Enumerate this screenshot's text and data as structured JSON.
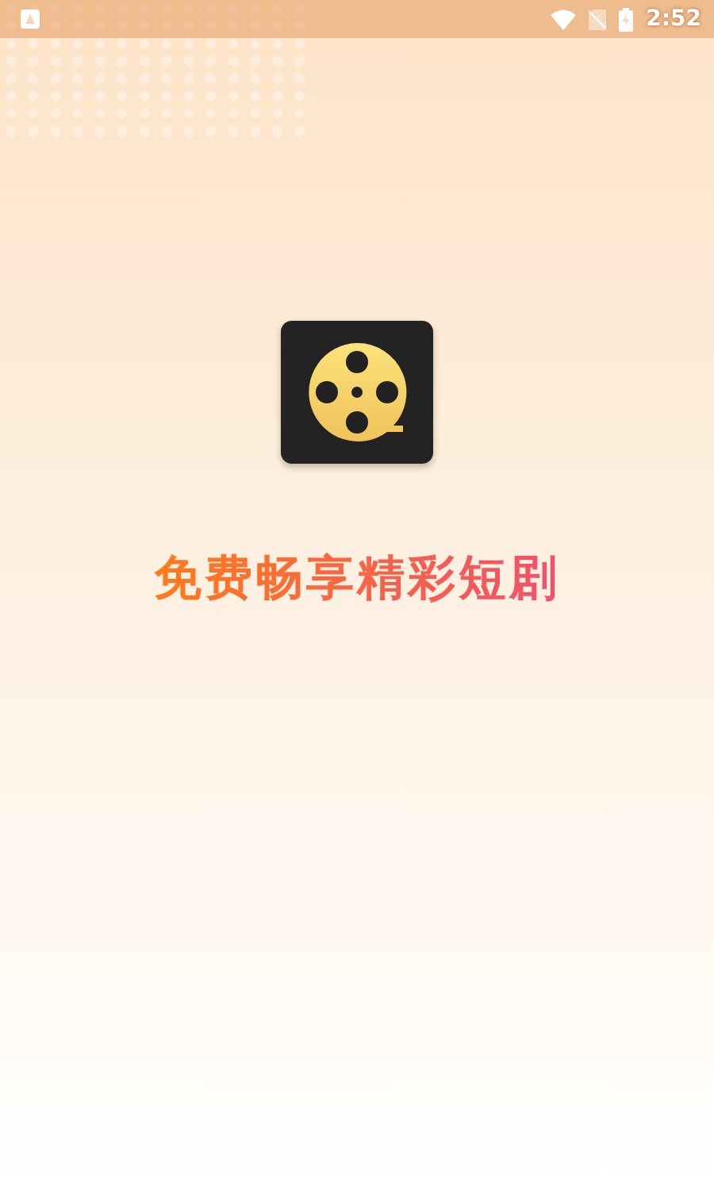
{
  "status_bar": {
    "time": "2:52"
  },
  "tagline": "免费畅享精彩短剧"
}
